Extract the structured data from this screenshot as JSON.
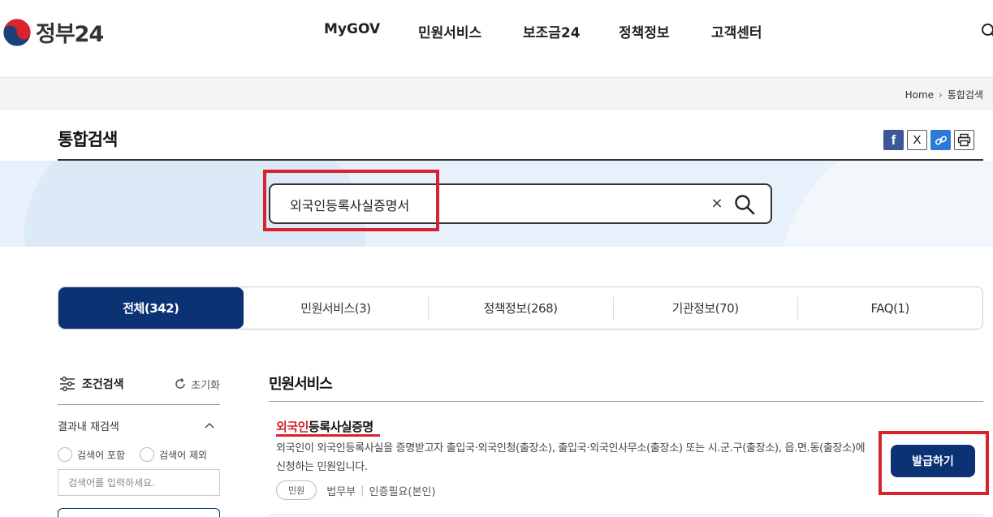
{
  "header": {
    "logo_text": "정부24",
    "nav": [
      "MyGOV",
      "민원서비스",
      "보조금24",
      "정책정보",
      "고객센터"
    ]
  },
  "breadcrumb": {
    "home": "Home",
    "current": "통합검색"
  },
  "page": {
    "title": "통합검색"
  },
  "share": {
    "facebook": "f",
    "x": "X"
  },
  "search": {
    "value": "외국인등록사실증명서",
    "clear": "×"
  },
  "tabs": [
    {
      "label": "전체(342)",
      "active": true
    },
    {
      "label": "민원서비스(3)",
      "active": false
    },
    {
      "label": "정책정보(268)",
      "active": false
    },
    {
      "label": "기관정보(70)",
      "active": false
    },
    {
      "label": "FAQ(1)",
      "active": false
    }
  ],
  "filter": {
    "title": "조건검색",
    "reset": "초기화",
    "refine_label": "결과내 재검색",
    "include": "검색어 포함",
    "exclude": "검색어 제외",
    "placeholder": "검색어를 입력하세요."
  },
  "results": {
    "section_title": "민원서비스",
    "item": {
      "title_highlight": "외국인",
      "title_rest": "등록사실증명",
      "description": "외국인이 외국인등록사실을 증명받고자 출입국·외국인청(출장소), 출입국·외국인사무소(출장소) 또는 시.군.구(출장소), 읍.면.동(출장소)에 신청하는 민원입니다.",
      "tag": "민원",
      "department": "법무부",
      "auth": "인증필요(본인)",
      "button": "발급하기"
    }
  },
  "colors": {
    "brand_navy": "#0b3374",
    "highlight_red": "#d9222d",
    "search_band": "#e8f1fb"
  }
}
